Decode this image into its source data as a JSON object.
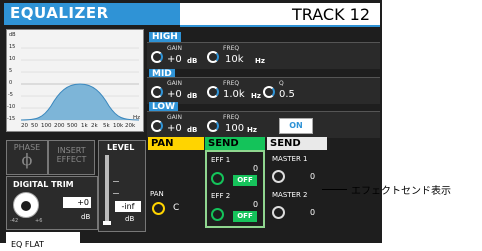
{
  "header": {
    "title": "EQUALIZER",
    "track": "TRACK 12"
  },
  "graph": {
    "y_ticks": [
      "dB",
      "15",
      "10",
      "5",
      "0",
      "-5",
      "-10",
      "-15"
    ],
    "x_ticks": [
      "20",
      "50",
      "100",
      "200",
      "500",
      "1k",
      "2k",
      "5k",
      "10k",
      "20k",
      "Hz"
    ]
  },
  "high": {
    "label": "HIGH",
    "gain_label": "GAIN",
    "gain": "+0",
    "gain_unit": "dB",
    "freq_label": "FREQ",
    "freq": "10k",
    "freq_unit": "Hz"
  },
  "mid": {
    "label": "MID",
    "gain_label": "GAIN",
    "gain": "+0",
    "gain_unit": "dB",
    "freq_label": "FREQ",
    "freq": "1.0k",
    "freq_unit": "Hz",
    "q_label": "Q",
    "q": "0.5"
  },
  "low": {
    "label": "LOW",
    "gain_label": "GAIN",
    "gain": "+0",
    "gain_unit": "dB",
    "freq_label": "FREQ",
    "freq": "100",
    "freq_unit": "Hz"
  },
  "eq_on": "ON",
  "phase": {
    "label": "PHASE",
    "symbol": "ϕ"
  },
  "insert": {
    "line1": "INSERT",
    "line2": "EFFECT"
  },
  "level": {
    "label": "LEVEL",
    "value": "-inf",
    "unit": "dB"
  },
  "trim": {
    "label": "DIGITAL TRIM",
    "value": "+0",
    "unit": "dB",
    "min": "-42",
    "max": "+6"
  },
  "pan": {
    "tab": "PAN",
    "label": "PAN",
    "value": "C"
  },
  "send1": {
    "tab": "SEND",
    "eff1_label": "EFF 1",
    "eff1_value": "0",
    "eff1_state": "OFF",
    "eff2_label": "EFF 2",
    "eff2_value": "0",
    "eff2_state": "OFF"
  },
  "send2": {
    "tab": "SEND",
    "master1_label": "MASTER 1",
    "master1_value": "0",
    "master2_label": "MASTER 2",
    "master2_value": "0"
  },
  "footer": {
    "eq_flat": "EQ FLAT"
  },
  "callout": "エフェクトセンド表示",
  "colors": {
    "accent": "#2f93d6",
    "pan": "#ffd400",
    "send": "#14c35a",
    "off": "#16c35b"
  }
}
